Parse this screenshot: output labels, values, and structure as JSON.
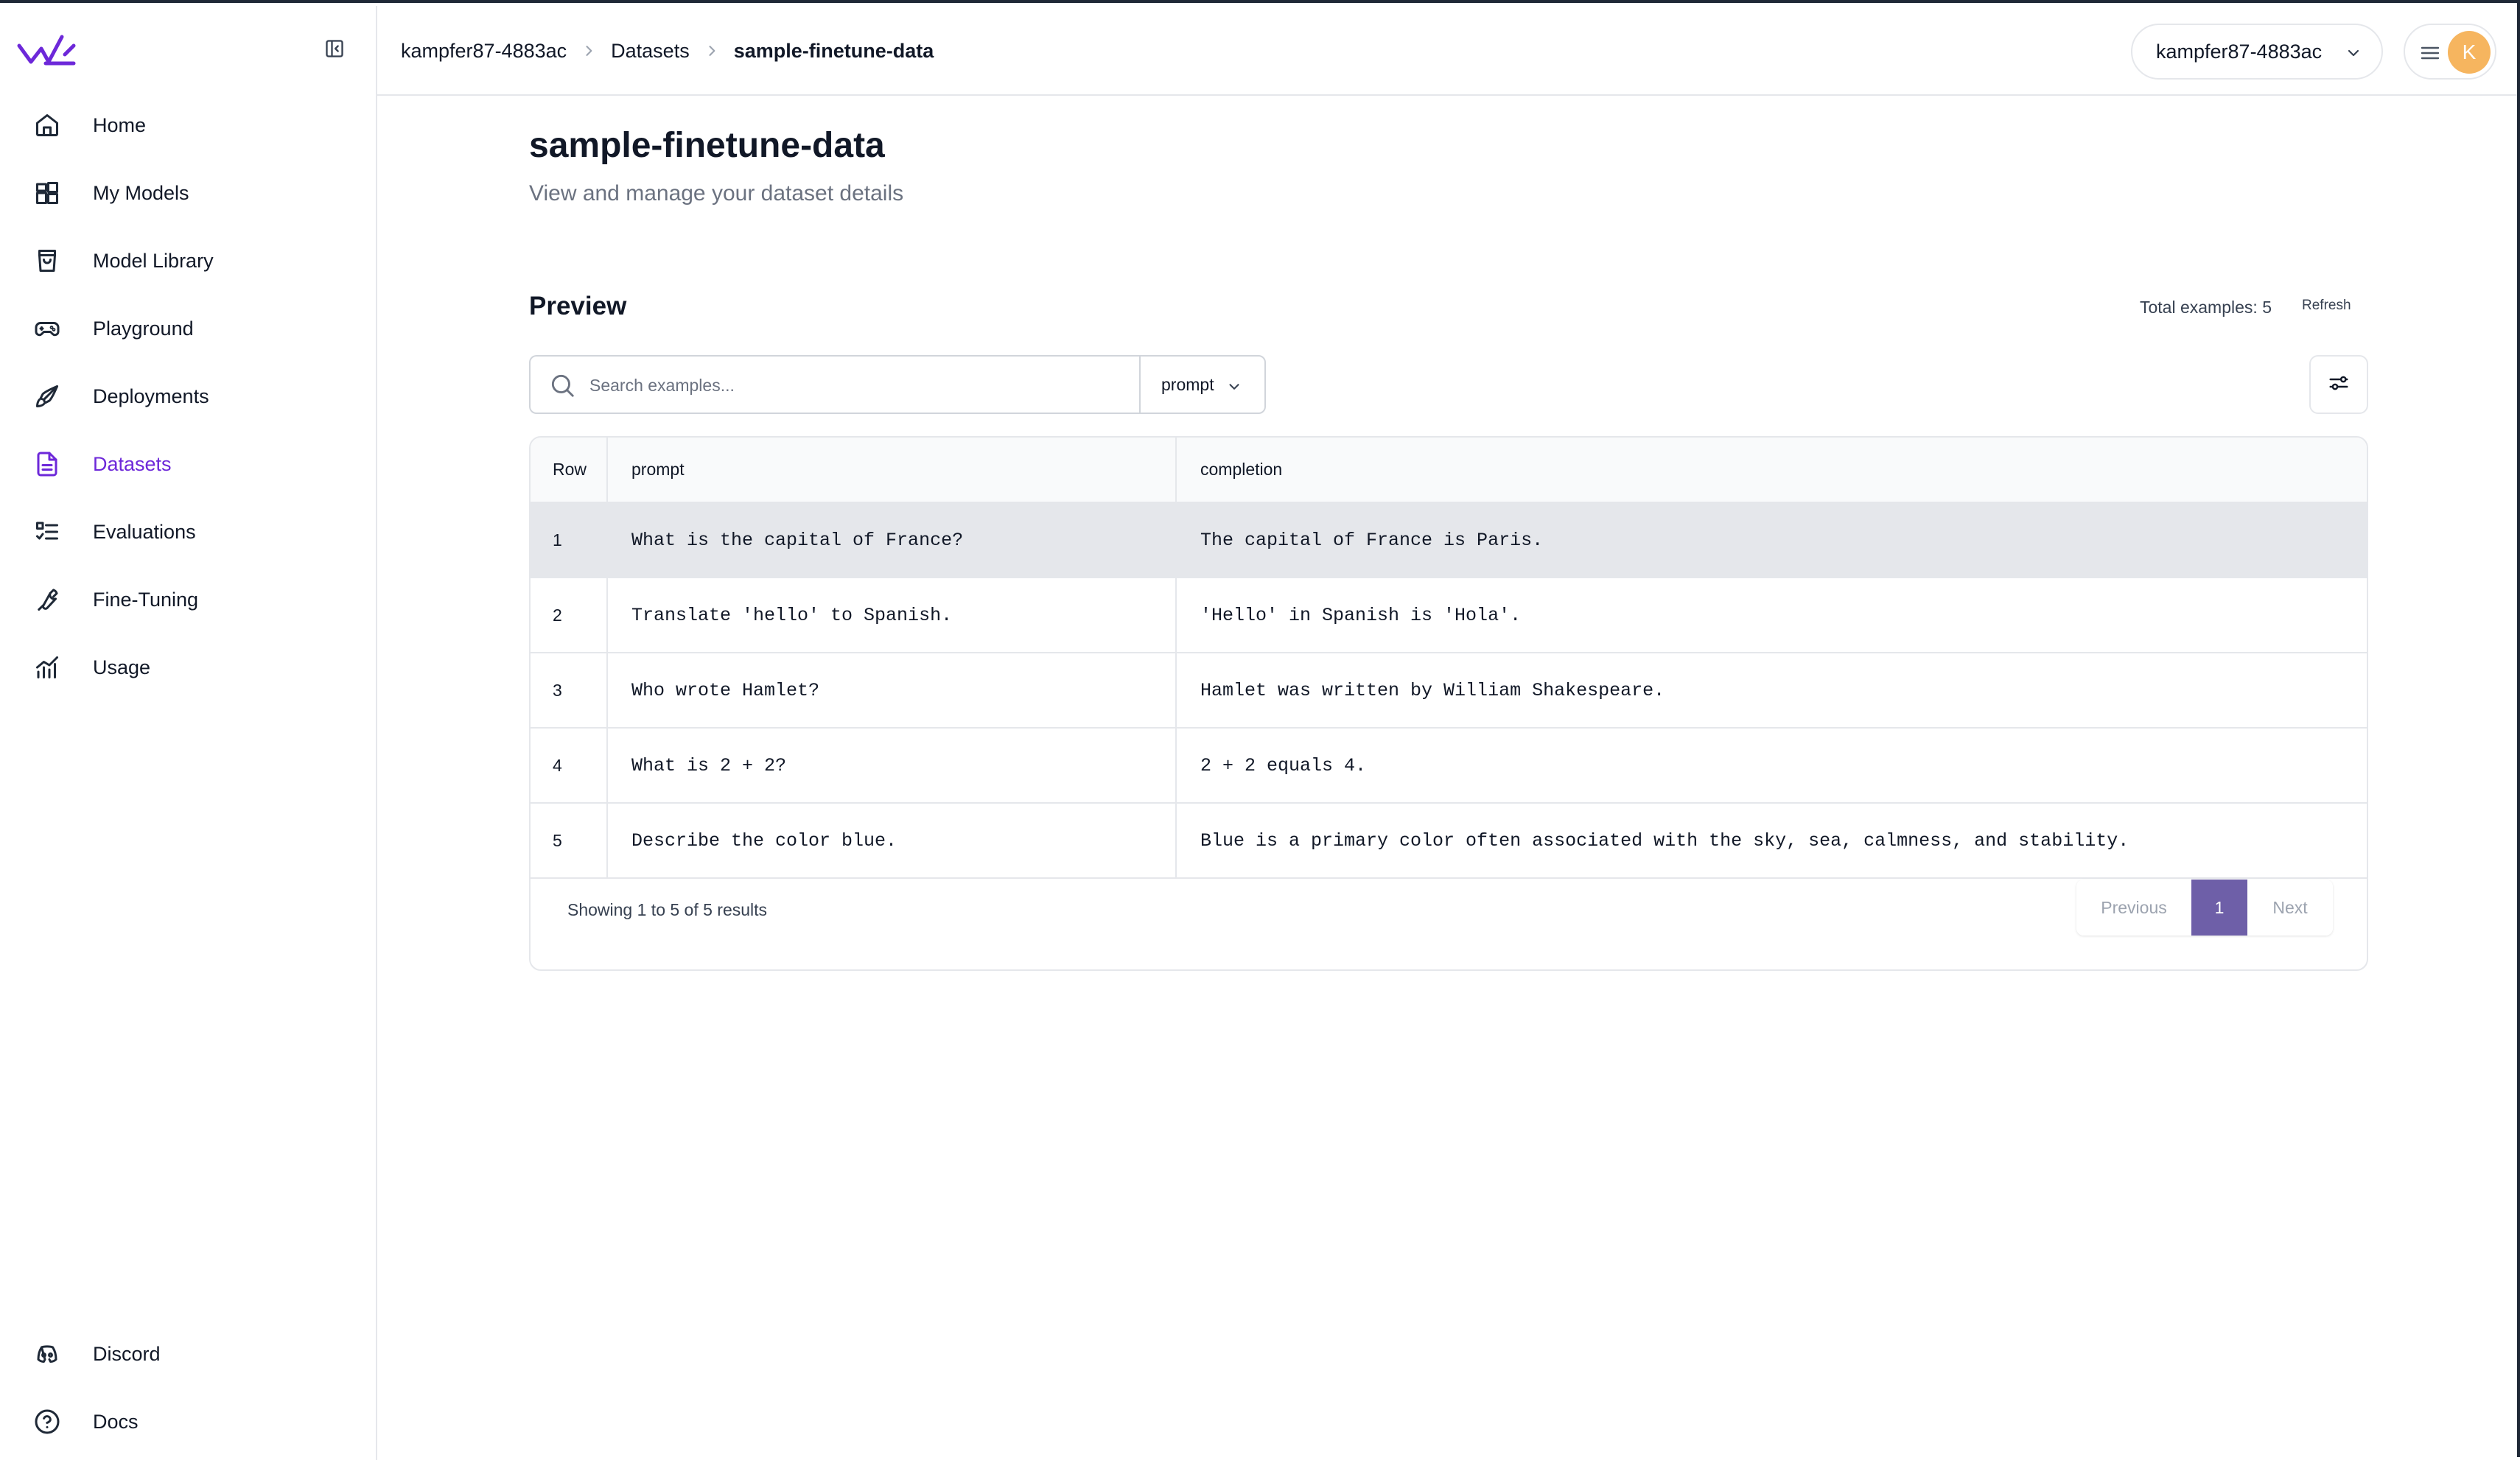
{
  "sidebar": {
    "items": [
      {
        "label": "Home",
        "icon": "home-icon"
      },
      {
        "label": "My Models",
        "icon": "models-icon"
      },
      {
        "label": "Model Library",
        "icon": "shopping-bag-icon"
      },
      {
        "label": "Playground",
        "icon": "gamepad-icon"
      },
      {
        "label": "Deployments",
        "icon": "rocket-icon"
      },
      {
        "label": "Datasets",
        "icon": "document-icon",
        "active": true
      },
      {
        "label": "Evaluations",
        "icon": "checklist-icon"
      },
      {
        "label": "Fine-Tuning",
        "icon": "wrench-icon"
      },
      {
        "label": "Usage",
        "icon": "chart-icon"
      }
    ],
    "bottom_items": [
      {
        "label": "Discord",
        "icon": "discord-icon"
      },
      {
        "label": "Docs",
        "icon": "help-circle-icon"
      }
    ]
  },
  "breadcrumb": {
    "org": "kampfer87-4883ac",
    "section": "Datasets",
    "current": "sample-finetune-data"
  },
  "header": {
    "org_selector": "kampfer87-4883ac",
    "avatar_initial": "K"
  },
  "page": {
    "title": "sample-finetune-data",
    "subtitle": "View and manage your dataset details"
  },
  "preview": {
    "title": "Preview",
    "total_examples": "Total examples: 5",
    "refresh_label": "Refresh",
    "search_placeholder": "Search examples...",
    "column_filter": "prompt",
    "columns": [
      "Row",
      "prompt",
      "completion"
    ],
    "rows": [
      {
        "row": "1",
        "prompt": "What is the capital of France?",
        "completion": "The capital of France is Paris."
      },
      {
        "row": "2",
        "prompt": "Translate 'hello' to Spanish.",
        "completion": "'Hello' in Spanish is 'Hola'."
      },
      {
        "row": "3",
        "prompt": "Who wrote Hamlet?",
        "completion": "Hamlet was written by William Shakespeare."
      },
      {
        "row": "4",
        "prompt": "What is 2 + 2?",
        "completion": "2 + 2 equals 4."
      },
      {
        "row": "5",
        "prompt": "Describe the color blue.",
        "completion": "Blue is a primary color often associated with the sky, sea, calmness, and stability."
      }
    ],
    "pagination": {
      "summary": "Showing 1 to 5 of 5 results",
      "previous": "Previous",
      "current_page": "1",
      "next": "Next"
    }
  },
  "colors": {
    "accent": "#6d28d9",
    "pager_active": "#6e5fa8",
    "avatar": "#f6b55f"
  }
}
